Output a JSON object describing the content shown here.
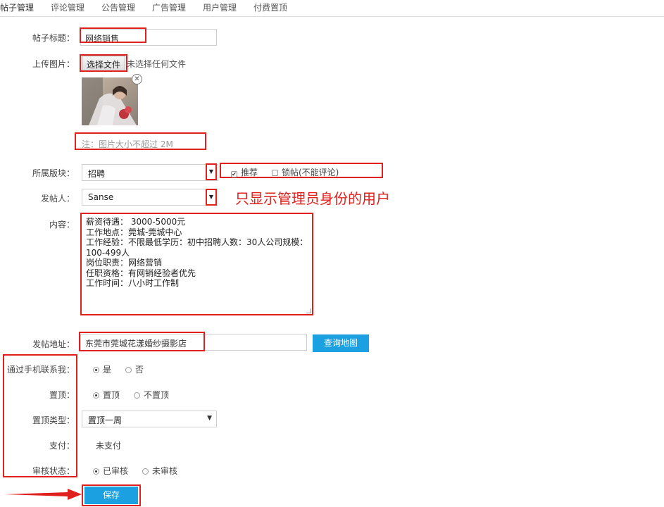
{
  "tabs": [
    {
      "label": "帖子管理"
    },
    {
      "label": "评论管理"
    },
    {
      "label": "公告管理"
    },
    {
      "label": "广告管理"
    },
    {
      "label": "用户管理"
    },
    {
      "label": "付费置顶"
    }
  ],
  "form": {
    "title": {
      "label": "帖子标题：",
      "value": "网络销售"
    },
    "upload": {
      "label": "上传图片：",
      "button": "选择文件",
      "status": "未选择任何文件",
      "remove_icon": "close-icon",
      "note": "注：图片大小不超过 2M"
    },
    "section": {
      "label": "所属版块：",
      "value": "招聘",
      "options": [
        {
          "label": "推荐",
          "checked": true
        },
        {
          "label": "锁帖(不能评论)",
          "checked": false
        }
      ]
    },
    "poster": {
      "label": "发帖人：",
      "value": "Sanse",
      "annotation": "只显示管理员身份的用户"
    },
    "content": {
      "label": "内容：",
      "lines": [
        "薪资待遇： 3000-5000元",
        "工作地点：莞城-莞城中心",
        "工作经验：不限最低学历：初中招聘人数：30人公司规模：",
        "100-499人",
        "岗位职责：网络营销",
        "任职资格：有网销经验者优先",
        "工作时间：八小时工作制"
      ]
    },
    "address": {
      "label": "发帖地址：",
      "value": "东莞市莞城花漾婚纱摄影店",
      "map_button": "查询地图"
    },
    "contact": {
      "label": "通过手机联系我：",
      "options": [
        {
          "label": "是",
          "checked": true
        },
        {
          "label": "否",
          "checked": false
        }
      ]
    },
    "top": {
      "label": "置顶：",
      "options": [
        {
          "label": "置顶",
          "checked": true
        },
        {
          "label": "不置顶",
          "checked": false
        }
      ]
    },
    "top_type": {
      "label": "置顶类型：",
      "value": "置顶一周"
    },
    "payment": {
      "label": "支付：",
      "value": "未支付"
    },
    "review": {
      "label": "审核状态：",
      "options": [
        {
          "label": "已审核",
          "checked": true
        },
        {
          "label": "未审核",
          "checked": false
        }
      ]
    },
    "save_button": "保存"
  },
  "colors": {
    "annotation_red": "#e0201c",
    "button_blue": "#1ba1e2"
  }
}
